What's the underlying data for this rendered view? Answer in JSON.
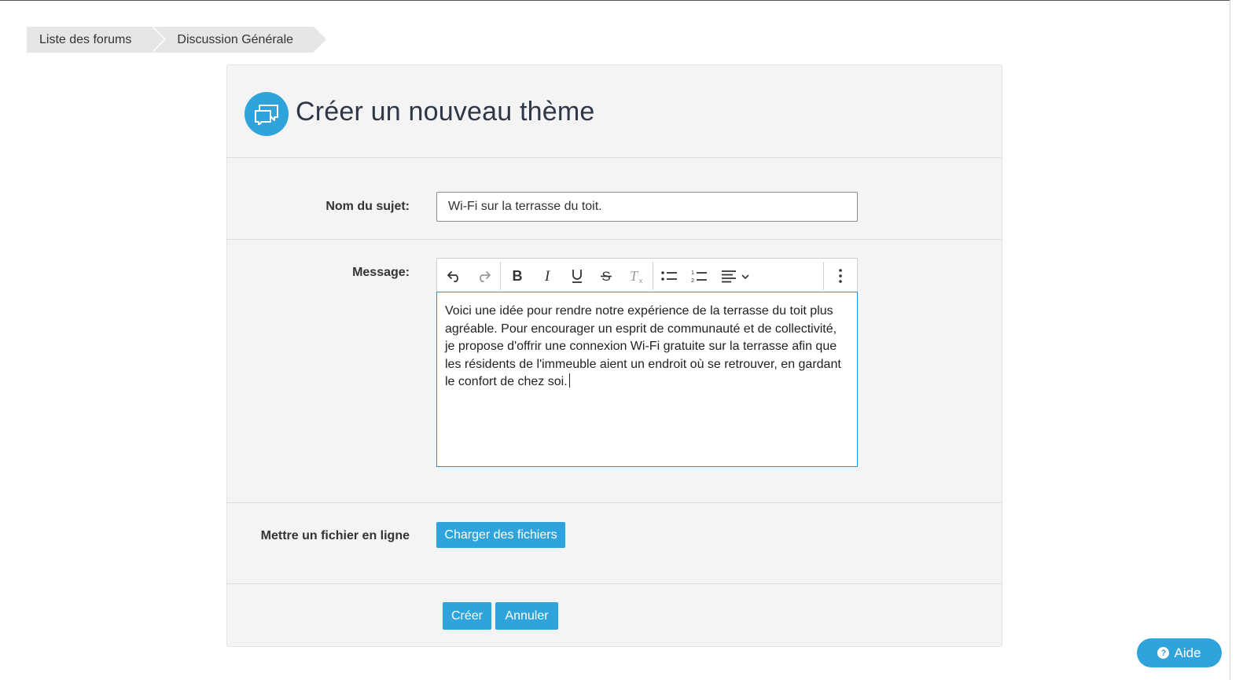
{
  "breadcrumb": {
    "items": [
      "Liste des forums",
      "Discussion Générale"
    ]
  },
  "header": {
    "icon": "chat-bubbles-icon",
    "title": "Créer un nouveau thème"
  },
  "form": {
    "subject_label": "Nom du sujet:",
    "subject_value": "Wi-Fi sur la terrasse du toit.",
    "message_label": "Message:",
    "message_text": "Voici une idée pour rendre notre expérience de la terrasse du toit plus agréable. Pour encourager un esprit de communauté et de collectivité, je propose d'offrir une connexion Wi-Fi gratuite sur la terrasse afin que les résidents de l'immeuble aient un endroit où se retrouver, en gardant le confort de chez soi.",
    "upload_label": "Mettre un fichier en ligne",
    "upload_button": "Charger des fichiers"
  },
  "toolbar": {
    "icons": [
      "undo-icon",
      "redo-icon",
      "bold-icon",
      "italic-icon",
      "underline-icon",
      "strikethrough-icon",
      "clear-format-icon",
      "bullet-list-icon",
      "numbered-list-icon",
      "align-icon",
      "more-icon"
    ]
  },
  "actions": {
    "create": "Créer",
    "cancel": "Annuler"
  },
  "help": {
    "label": "Aide"
  },
  "colors": {
    "accent": "#2fa4dc",
    "panel_bg": "#f4f4f4",
    "editor_focus_border": "#2c8fd8"
  }
}
